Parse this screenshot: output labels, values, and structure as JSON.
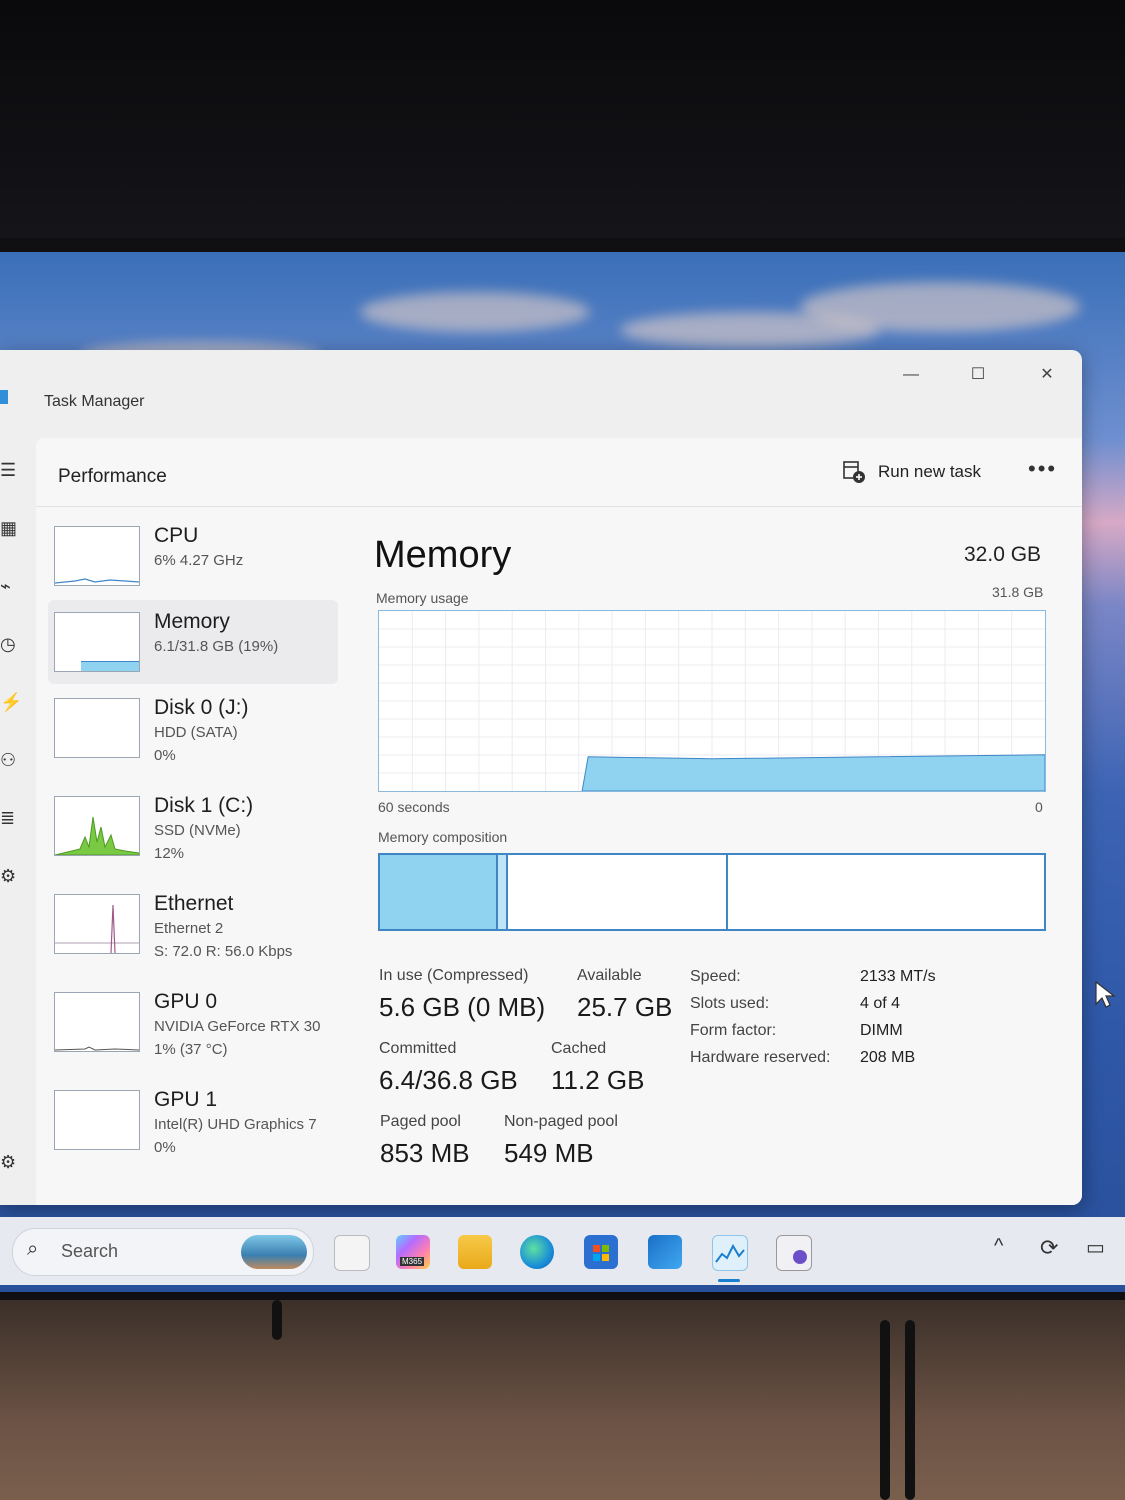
{
  "window": {
    "title": "Task Manager",
    "minimize": "—",
    "maximize": "☐",
    "close": "✕"
  },
  "header": {
    "title": "Performance",
    "run_new_task": "Run new task",
    "more": "•••"
  },
  "devices": [
    {
      "name": "CPU",
      "sub": "6% 4.27 GHz",
      "sub2": ""
    },
    {
      "name": "Memory",
      "sub": "6.1/31.8 GB (19%)",
      "sub2": ""
    },
    {
      "name": "Disk 0 (J:)",
      "sub": "HDD (SATA)",
      "sub2": "0%"
    },
    {
      "name": "Disk 1 (C:)",
      "sub": "SSD (NVMe)",
      "sub2": "12%"
    },
    {
      "name": "Ethernet",
      "sub": "Ethernet 2",
      "sub2": "S: 72.0 R: 56.0 Kbps"
    },
    {
      "name": "GPU 0",
      "sub": "NVIDIA GeForce RTX 30",
      "sub2": "1% (37 °C)"
    },
    {
      "name": "GPU 1",
      "sub": "Intel(R) UHD Graphics 7",
      "sub2": "0%"
    }
  ],
  "memory": {
    "title": "Memory",
    "total": "32.0 GB",
    "usage_label": "Memory usage",
    "usage_max": "31.8 GB",
    "axis_left": "60 seconds",
    "axis_right": "0",
    "composition_label": "Memory composition",
    "usage_fraction": 0.19,
    "stats": {
      "in_use_label": "In use (Compressed)",
      "in_use": "5.6 GB (0 MB)",
      "available_label": "Available",
      "available": "25.7 GB",
      "committed_label": "Committed",
      "committed": "6.4/36.8 GB",
      "cached_label": "Cached",
      "cached": "11.2 GB",
      "paged_label": "Paged pool",
      "paged": "853 MB",
      "nonpaged_label": "Non-paged pool",
      "nonpaged": "549 MB"
    },
    "specs": {
      "speed_label": "Speed:",
      "speed": "2133 MT/s",
      "slots_label": "Slots used:",
      "slots": "4 of 4",
      "form_label": "Form factor:",
      "form": "DIMM",
      "reserved_label": "Hardware reserved:",
      "reserved": "208 MB"
    }
  },
  "taskbar": {
    "search_placeholder": "Search",
    "m365_badge": "M365"
  },
  "colors": {
    "accent": "#3f86c7",
    "memory_fill": "#8fd3f0",
    "disk_fill": "#7ac943",
    "window_bg": "#efeff0"
  }
}
